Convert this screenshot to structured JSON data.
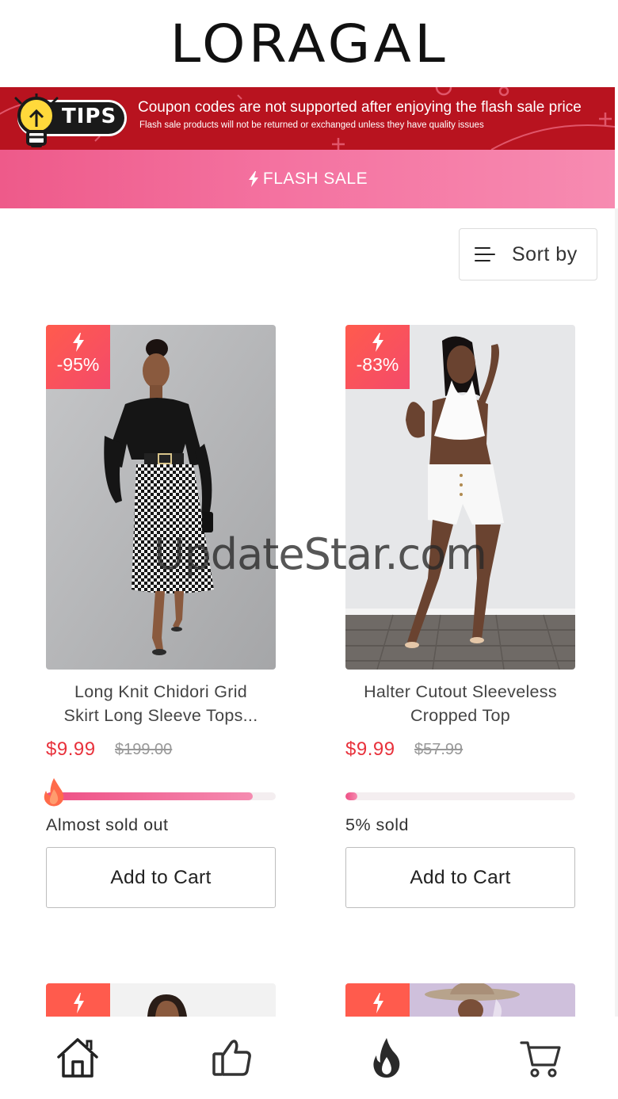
{
  "header": {
    "logo": "LORAGAL"
  },
  "tips": {
    "badge": "TIPS",
    "line1": "Coupon codes are not supported after enjoying the flash sale price",
    "line2": "Flash sale products will not be returned or exchanged unless they have quality issues"
  },
  "flash_sale": {
    "label": "FLASH SALE",
    "icon": "lightning-icon"
  },
  "sort": {
    "label": "Sort by",
    "icon": "sort-lines-icon"
  },
  "products": [
    {
      "discount": "-95%",
      "title_line1": "Long Knit Chidori Grid",
      "title_line2": "Skirt Long Sleeve Tops...",
      "price": "$9.99",
      "old_price": "$199.00",
      "sold_fraction": 0.9,
      "sold_text": "Almost sold out",
      "cart_label": "Add to Cart"
    },
    {
      "discount": "-83%",
      "title_line1": "Halter Cutout Sleeveless",
      "title_line2": "Cropped Top",
      "price": "$9.99",
      "old_price": "$57.99",
      "sold_fraction": 0.05,
      "sold_text": "5% sold",
      "cart_label": "Add to Cart"
    }
  ],
  "watermark": "UpdateStar.com",
  "nav": [
    {
      "icon": "home-icon"
    },
    {
      "icon": "thumbs-up-icon"
    },
    {
      "icon": "flame-icon"
    },
    {
      "icon": "cart-icon"
    }
  ],
  "colors": {
    "tips_bg": "#b8131f",
    "flash_gradient_start": "#ee5a8a",
    "flash_gradient_end": "#f78bb1",
    "price": "#e8323c",
    "discount_badge": "#ff5b4d"
  }
}
